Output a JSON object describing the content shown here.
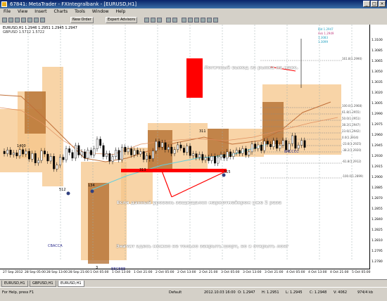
{
  "window": {
    "title": "67841: MetaTrader - FXIntegralbank - [EURUSD,H1]"
  },
  "menu": [
    "File",
    "View",
    "Insert",
    "Charts",
    "Tools",
    "Window",
    "Help"
  ],
  "toolbar": {
    "new_order": "New Order",
    "expert_advisors": "Expert Advisors"
  },
  "chart": {
    "title": "EURUSD,H1  1.2946 1.2951 1.2945 1.2947",
    "subtitle": "GBPUSD 1.5712 1.5722",
    "price_labels": [
      "1.3100",
      "1.3085",
      "1.3065",
      "1.3050",
      "1.3035",
      "1.3020",
      "1.3005",
      "1.2990",
      "1.2975",
      "1.2960",
      "1.2945",
      "1.2930",
      "1.2915",
      "1.2900",
      "1.2885",
      "1.2870",
      "1.2855",
      "1.2840",
      "1.2825",
      "1.2810",
      "1.2795",
      "1.2780"
    ],
    "time_labels": [
      "27 Sep 2012",
      "28 Sep 05:00",
      "28 Sep 13:00",
      "28 Sep 21:00",
      "1 Oct 05:00",
      "1 Oct 13:00",
      "1 Oct 21:00",
      "2 Oct 05:00",
      "2 Oct 13:00",
      "2 Oct 21:00",
      "3 Oct 05:00",
      "3 Oct 13:00",
      "3 Oct 21:00",
      "4 Oct 05:00",
      "4 Oct 13:00",
      "4 Oct 21:00",
      "5 Oct 05:00"
    ],
    "annotations": {
      "exit": "Логичный выход из рынка на макс.",
      "level": "Если данный уровень защищался маркетмейкром уже 2 раза",
      "long": "Значит здесь можно не только закрыть шорт, но и открыть лонг"
    },
    "small_labels": {
      "cbacca": "CBACCA",
      "bbcbbe": "BBCBBE",
      "baccc": "BACCCC",
      "n512": "512",
      "n134": "134",
      "n1400": "1400",
      "n3": "3",
      "n311": "311",
      "n313": "313",
      "n315": "315"
    },
    "fib_labels": [
      "100.0(1.2968)",
      "61.8(1.2955)",
      "50.0(1.2951)",
      "38.2(1.2947)",
      "23.6(1.2942)",
      "0.0(1.2934)",
      "-23.6(1.2925)",
      "-38.2(1.2920)",
      "-61.8(1.2912)",
      "-100.0(1.2899)",
      "161.8(1.2990)"
    ],
    "top_right_labels": [
      "Bid 1.2947",
      "Ask 1.2949",
      "1.3083",
      "1.3099"
    ]
  },
  "tabs": [
    "EURUSD,H1",
    "GBPUSD,H1",
    "EURUSD,H1"
  ],
  "status": {
    "help": "For Help, press F1",
    "profile": "Default",
    "datetime": "2012.10.03 16:00",
    "open": "O: 1.2947",
    "high": "H: 1.2951",
    "low": "L: 1.2945",
    "close": "C: 1.2948",
    "volume": "V: 4062",
    "traffic": "974/4 kb"
  },
  "colors": {
    "bull_candle": "#000000",
    "bear_candle": "#000000",
    "zone_fill": "#f5c58a",
    "zone_dark": "#b06a2a",
    "red_level": "#ff0000",
    "annotation_text": "#ffffff"
  }
}
